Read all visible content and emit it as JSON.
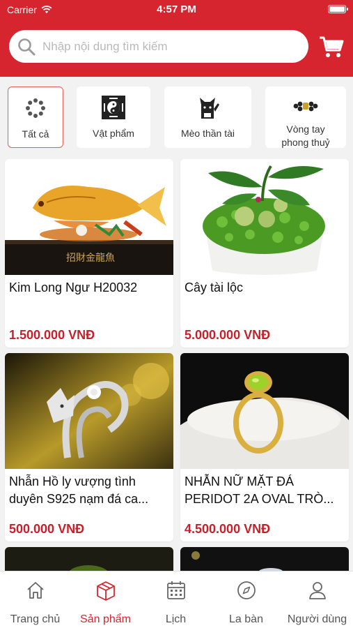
{
  "status": {
    "carrier": "Carrier",
    "time": "4:57 PM"
  },
  "search": {
    "placeholder": "Nhập nội dung tìm kiếm"
  },
  "categories": [
    {
      "label": "Tất cả",
      "icon": "bead-circle-icon"
    },
    {
      "label": "Vật phẩm",
      "icon": "bagua-icon"
    },
    {
      "label": "Mèo thần tài",
      "icon": "lucky-cat-icon"
    },
    {
      "label": "Vòng tay phong thuỷ",
      "icon": "bracelet-icon"
    }
  ],
  "products": [
    {
      "name": "Kim Long Ngư H20032",
      "price": "1.500.000 VNĐ"
    },
    {
      "name": "Cây tài lộc",
      "price": "5.000.000 VNĐ"
    },
    {
      "name": "Nhẫn Hồ ly vượng tình duyên S925 nạm đá ca...",
      "price": "500.000 VNĐ"
    },
    {
      "name": "NHẪN NỮ MẶT ĐÁ PERIDOT 2A OVAL TRÒ...",
      "price": "4.500.000 VNĐ"
    }
  ],
  "tabs": [
    {
      "label": "Trang chủ",
      "icon": "home-icon"
    },
    {
      "label": "Sản phẩm",
      "icon": "box-icon"
    },
    {
      "label": "Lịch",
      "icon": "calendar-icon"
    },
    {
      "label": "La bàn",
      "icon": "compass-icon"
    },
    {
      "label": "Người dùng",
      "icon": "user-icon"
    }
  ],
  "colors": {
    "brand": "#d6252e",
    "price": "#c8202a"
  }
}
